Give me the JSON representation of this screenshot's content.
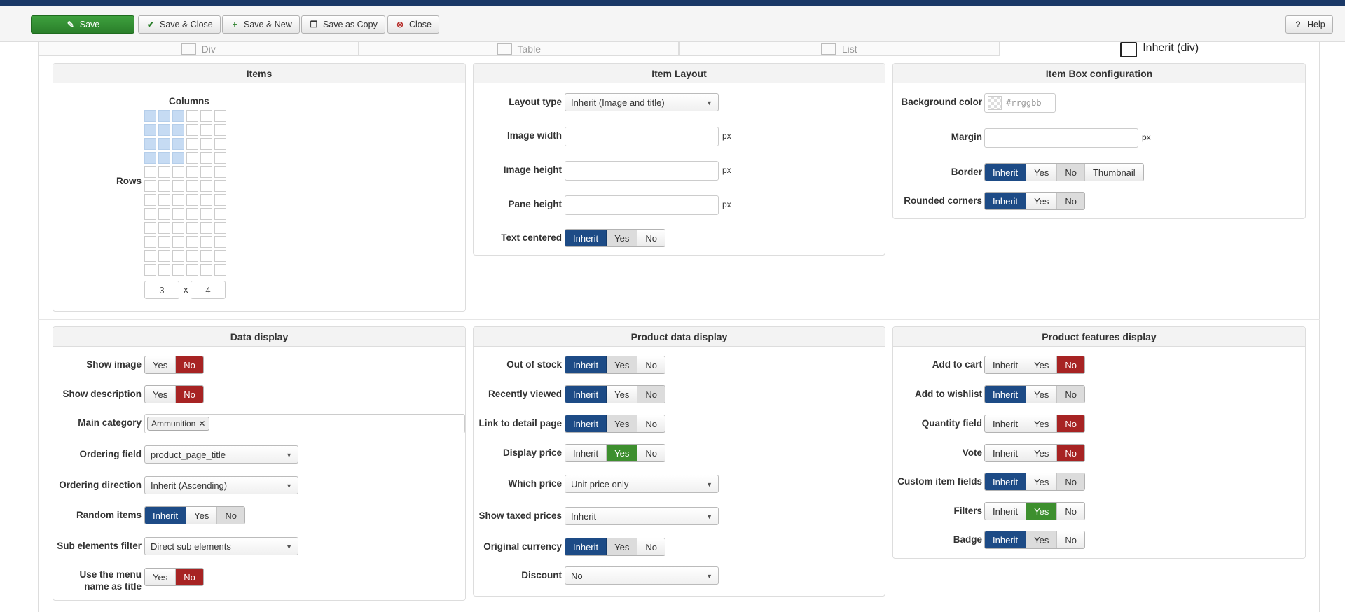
{
  "toolbar": {
    "save": "Save",
    "save_close": "Save & Close",
    "save_new": "Save & New",
    "save_copy": "Save as Copy",
    "close": "Close",
    "help": "Help"
  },
  "tabs": [
    "Div",
    "Table",
    "List",
    "Inherit (div)"
  ],
  "items": {
    "title": "Items",
    "columns_label": "Columns",
    "rows_label": "Rows",
    "grid_cols": 6,
    "grid_rows": 12,
    "selected_cols": 3,
    "selected_rows": 4,
    "cols_value": "3",
    "x_label": "x",
    "rows_value": "4"
  },
  "item_layout": {
    "title": "Item Layout",
    "layout_type_label": "Layout type",
    "layout_type_value": "Inherit (Image and title)",
    "image_width_label": "Image width",
    "image_height_label": "Image height",
    "pane_height_label": "Pane height",
    "unit": "px",
    "text_centered_label": "Text centered",
    "text_centered": [
      "Inherit",
      "Yes",
      "No"
    ]
  },
  "item_box": {
    "title": "Item Box configuration",
    "bg_color_label": "Background color",
    "bg_color_placeholder": "#rrggbb",
    "margin_label": "Margin",
    "unit": "px",
    "border_label": "Border",
    "border_options": [
      "Inherit",
      "Yes",
      "No",
      "Thumbnail"
    ],
    "rounded_label": "Rounded corners",
    "rounded_options": [
      "Inherit",
      "Yes",
      "No"
    ]
  },
  "data_display": {
    "title": "Data display",
    "show_image_label": "Show image",
    "show_desc_label": "Show description",
    "yes": "Yes",
    "no": "No",
    "main_cat_label": "Main category",
    "main_cat_chip": "Ammunition",
    "ordering_field_label": "Ordering field",
    "ordering_field_value": "product_page_title",
    "ordering_dir_label": "Ordering direction",
    "ordering_dir_value": "Inherit (Ascending)",
    "random_label": "Random items",
    "random_options": [
      "Inherit",
      "Yes",
      "No"
    ],
    "sub_filter_label": "Sub elements filter",
    "sub_filter_value": "Direct sub elements",
    "menu_name_label_1": "Use the menu",
    "menu_name_label_2": "name as title"
  },
  "product_data": {
    "title": "Product data display",
    "out_of_stock_label": "Out of stock",
    "recently_viewed_label": "Recently viewed",
    "link_detail_label": "Link to detail page",
    "display_price_label": "Display price",
    "which_price_label": "Which price",
    "which_price_value": "Unit price only",
    "taxed_label": "Show taxed prices",
    "taxed_value": "Inherit",
    "orig_currency_label": "Original currency",
    "discount_label": "Discount",
    "discount_value": "No",
    "options": [
      "Inherit",
      "Yes",
      "No"
    ]
  },
  "product_features": {
    "title": "Product features display",
    "add_cart_label": "Add to cart",
    "add_wishlist_label": "Add to wishlist",
    "qty_label": "Quantity field",
    "vote_label": "Vote",
    "custom_fields_label": "Custom item fields",
    "filters_label": "Filters",
    "badge_label": "Badge",
    "options": [
      "Inherit",
      "Yes",
      "No"
    ]
  }
}
